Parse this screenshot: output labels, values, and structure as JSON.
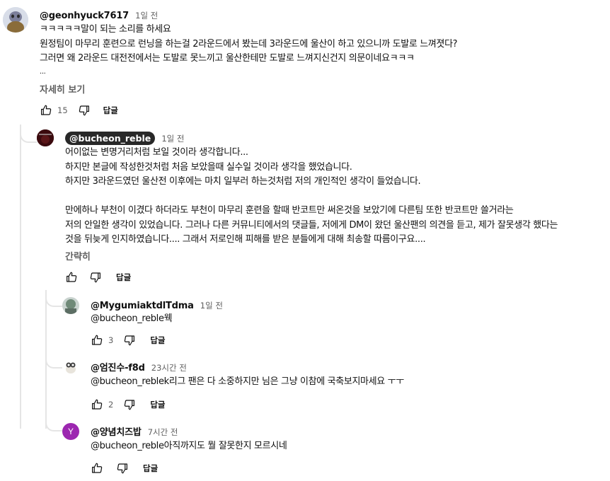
{
  "top_comment": {
    "author": "@geonhyuck7617",
    "time": "1일 전",
    "lines": [
      "ㅋㅋㅋㅋㅋ말이 되는 소리를 하세요",
      "원정팀이 마무리 훈련으로 런닝을 하는걸 2라운드에서 봤는데 3라운드에 울산이 하고 있으니까 도발로 느껴졋다?",
      "그러면 왜 2라운드 대전전에서는 도발로 못느끼고 울산한테만 도발로 느껴지신건지 의문이네요ㅋㅋㅋ",
      "..."
    ],
    "more_label": "자세히 보기",
    "likes": "15",
    "reply_label": "답글"
  },
  "creator_reply": {
    "author": "@bucheon_reble",
    "time": "1일 전",
    "lines": [
      "어이없는 변명거리처럼 보일 것이라 생각합니다...",
      "하지만 본글에 작성한것처럼 처음 보았을때 실수일 것이라 생각을 했었습니다.",
      "하지만 3라운드였던 울산전 이후에는 마치 일부러 하는것처럼 저의 개인적인 생각이 들었습니다.",
      "",
      "만에하나 부천이 이겼다 하더라도 부천이 마무리 훈련을 할때 반코트만 써온것을 보았기에 다른팀 또한 반코트만 쓸거라는",
      "저의 안일한 생각이 있었습니다. 그러나 다른 커뮤니티에서의 댓글들, 저에게 DM이 왔던 울산팬의 의견을 듣고, 제가 잘못생각 했다는",
      "것을 뒤늦게 인지하였습니다.... 그래서 저로인해 피해를 받은 분들에게 대해 최송할 따름이구요...."
    ],
    "less_label": "간략히",
    "likes": "",
    "reply_label": "답글"
  },
  "replies": [
    {
      "author": "@MygumiaktdlTdma",
      "time": "1일 전",
      "mention": "@bucheon_reble",
      "text": "웩",
      "likes": "3",
      "reply_label": "답글",
      "avatar_color": "#6f8a78"
    },
    {
      "author": "@엄진수-f8d",
      "time": "23시간 전",
      "mention": "@bucheon_reble",
      "text": "k리그 팬은 다 소중하지만 님은 그냥 이참에 국축보지마세요 ㅜㅜ",
      "likes": "2",
      "reply_label": "답글",
      "avatar_color": "#e6e6e6"
    },
    {
      "author": "@양념치즈밥",
      "time": "7시간 전",
      "mention": "@bucheon_reble",
      "text": "아직까지도 뭘 잘못한지 모르시네",
      "likes": "",
      "reply_label": "답글",
      "avatar_letter": "Y",
      "avatar_color": "#9c27b0"
    }
  ],
  "colors": {
    "text": "#0f0f0f",
    "meta": "#606060",
    "chip_bg": "#282828"
  }
}
